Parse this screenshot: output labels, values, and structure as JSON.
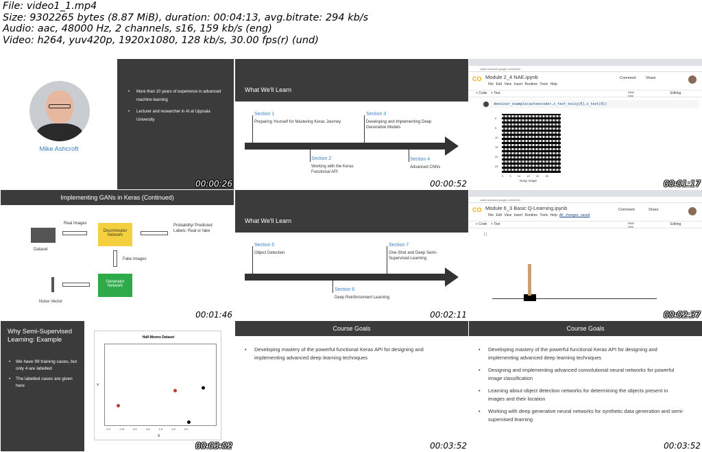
{
  "header": {
    "file": "File: video1_1.mp4",
    "size": "Size: 9302265 bytes (8.87 MiB), duration: 00:04:13, avg.bitrate: 294 kb/s",
    "audio": "Audio: aac, 48000 Hz, 2 channels, s16, 159 kb/s (eng)",
    "video": "Video: h264, yuv420p, 1920x1080, 128 kb/s, 30.00 fps(r) (und)"
  },
  "tiles": [
    {
      "ts": "00:00:26",
      "name": "Mike Ashcroft",
      "bullets": [
        "More than 10 years of experience in advanced machine learning",
        "Lecturer and researcher in AI at Uppsala University"
      ]
    },
    {
      "ts": "00:00:52",
      "title": "What We'll Learn",
      "sections": [
        {
          "n": "Section 1",
          "t": "Preparing Yourself for Mastering Keras Journey"
        },
        {
          "n": "Section 2",
          "t": "Working with the Keras Functional API"
        },
        {
          "n": "Section 3",
          "t": "Developing and Implementing Deep Generative Models"
        },
        {
          "n": "Section 4",
          "t": "Advanced CNNs"
        }
      ]
    },
    {
      "ts": "00:01:17",
      "title": "Module 2_4 NAE.ipynb",
      "menu": "File Edit View Insert Runtime Tools Help",
      "code": "denoiser_example(autoencoder,x_test_noisy[0],x_test[0])",
      "plot_label": "Noisy Image",
      "yticks": [
        "0",
        "5",
        "10",
        "15",
        "20",
        "25"
      ],
      "xticks": [
        "0",
        "5",
        "10",
        "15",
        "20",
        "25"
      ],
      "comment": "Comment",
      "share": "Share",
      "editing": "Editing",
      "add_code": "+ Code",
      "add_text": "+ Text",
      "ram": "RAM",
      "disk": "Disk",
      "url": "colab.research.google.com/drive/..."
    },
    {
      "ts": "00:01:46",
      "title": "Implementing GANs in Keras (Continued)",
      "dataset": "Dataset",
      "real": "Real Images",
      "disc": "Discriminator Network",
      "prob": "Probability/ Predicted Labels: Real or fake",
      "fake": "Fake Images",
      "gen": "Generator Network",
      "noise": "Noise Vector"
    },
    {
      "ts": "00:02:11",
      "title": "What We'll Learn",
      "sections": [
        {
          "n": "Section 5",
          "t": "Object Detection"
        },
        {
          "n": "Section 6",
          "t": "Deep Reinforcement Learning"
        },
        {
          "n": "Section 7",
          "t": "One-Shot and Deep Semi-Supervised Learning"
        }
      ]
    },
    {
      "ts": "00:02:37",
      "title": "Module 6_3 Basic Q-Learning.ipynb",
      "menu": "File Edit View Insert Runtime Tools Help",
      "saved": "All changes saved",
      "comment": "Comment",
      "share": "Share",
      "editing": "Editing",
      "add_code": "+ Code",
      "add_text": "+ Text",
      "cell": "[ ]",
      "ram": "RAM",
      "disk": "Disk",
      "url": "colab.research.google.com/drive/..."
    },
    {
      "ts": "00:03:02",
      "title": "Why Semi-Supervised Learning: Example",
      "bullets": [
        "We have 99 training cases, but only 4 are labelled",
        "The labelled cases are given here"
      ],
      "plot_title": "Half-Moons Dataset",
      "xlabel": "X",
      "ylabel": "Y",
      "xticks": [
        "-1.0",
        "-0.5",
        "0.0",
        "0.5",
        "1.0",
        "1.5",
        "2.0"
      ],
      "yticks": [
        "1.0",
        "0.5",
        "0.0",
        "-0.5"
      ]
    },
    {
      "ts": "00:03:52",
      "title": "Course Goals",
      "goals": [
        "Developing mastery of the powerful functional Keras API for designing and implementing advanced deep learning techniques"
      ]
    },
    {
      "ts": "00:03:52",
      "title": "Course Goals",
      "goals": [
        "Developing mastery of the powerful functional Keras API for designing and implementing advanced deep learning techniques",
        "Designing and implementing advanced convolutional neural networks for powerful image classification",
        "Learning about object detection networks for determining the objects present in images and their location",
        "Working with deep generative neural networks for synthetic data generation and semi-supervised learning"
      ]
    }
  ]
}
